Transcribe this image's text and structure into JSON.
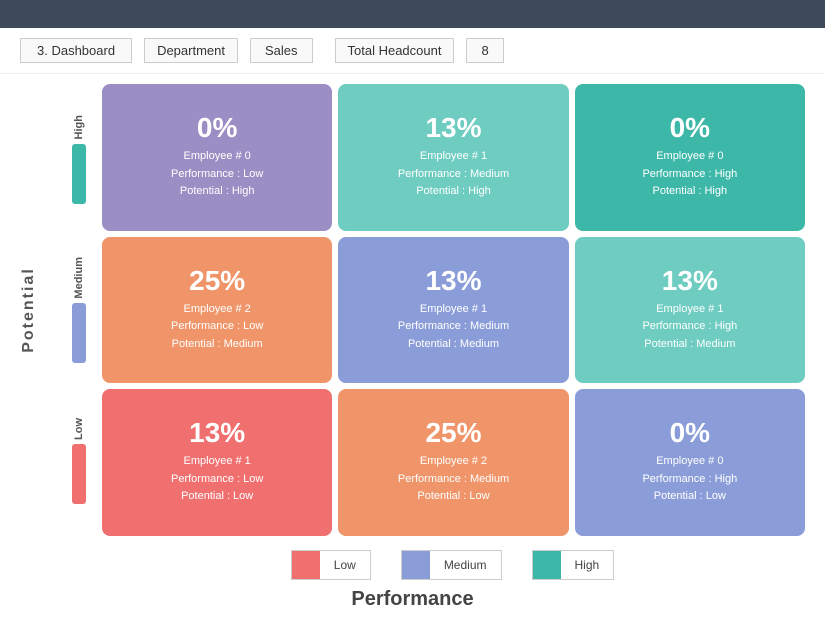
{
  "topbar": {},
  "header": {
    "title": "3. Dashboard",
    "dept_label": "Department",
    "dept_value": "Sales",
    "hc_label": "Total Headcount",
    "hc_value": "8"
  },
  "yaxis": {
    "label": "Potential"
  },
  "row_labels": [
    {
      "text": "High",
      "bar_class": "bar-high"
    },
    {
      "text": "Medium",
      "bar_class": "bar-medium"
    },
    {
      "text": "Low",
      "bar_class": "bar-low"
    }
  ],
  "grid": {
    "rows": [
      {
        "cells": [
          {
            "percent": "0%",
            "employee": "Employee # 0",
            "performance": "Performance : Low",
            "potential": "Potential : High",
            "color": "color-purple"
          },
          {
            "percent": "13%",
            "employee": "Employee # 1",
            "performance": "Performance : Medium",
            "potential": "Potential : High",
            "color": "color-teal-light"
          },
          {
            "percent": "0%",
            "employee": "Employee # 0",
            "performance": "Performance : High",
            "potential": "Potential : High",
            "color": "color-teal-dark"
          }
        ]
      },
      {
        "cells": [
          {
            "percent": "25%",
            "employee": "Employee # 2",
            "performance": "Performance : Low",
            "potential": "Potential : Medium",
            "color": "color-orange"
          },
          {
            "percent": "13%",
            "employee": "Employee # 1",
            "performance": "Performance : Medium",
            "potential": "Potential : Medium",
            "color": "color-blue-purple"
          },
          {
            "percent": "13%",
            "employee": "Employee # 1",
            "performance": "Performance : High",
            "potential": "Potential : Medium",
            "color": "color-teal-light"
          }
        ]
      },
      {
        "cells": [
          {
            "percent": "13%",
            "employee": "Employee # 1",
            "performance": "Performance : Low",
            "potential": "Potential : Low",
            "color": "color-red-orange"
          },
          {
            "percent": "25%",
            "employee": "Employee # 2",
            "performance": "Performance : Medium",
            "potential": "Potential : Low",
            "color": "color-orange"
          },
          {
            "percent": "0%",
            "employee": "Employee # 0",
            "performance": "Performance : High",
            "potential": "Potential : Low",
            "color": "color-blue-purple"
          }
        ]
      }
    ]
  },
  "legend": {
    "items": [
      {
        "label": "Low",
        "swatch_class": "swatch-low"
      },
      {
        "label": "Medium",
        "swatch_class": "swatch-medium"
      },
      {
        "label": "High",
        "swatch_class": "swatch-high"
      }
    ]
  },
  "xaxis": {
    "label": "Performance"
  }
}
